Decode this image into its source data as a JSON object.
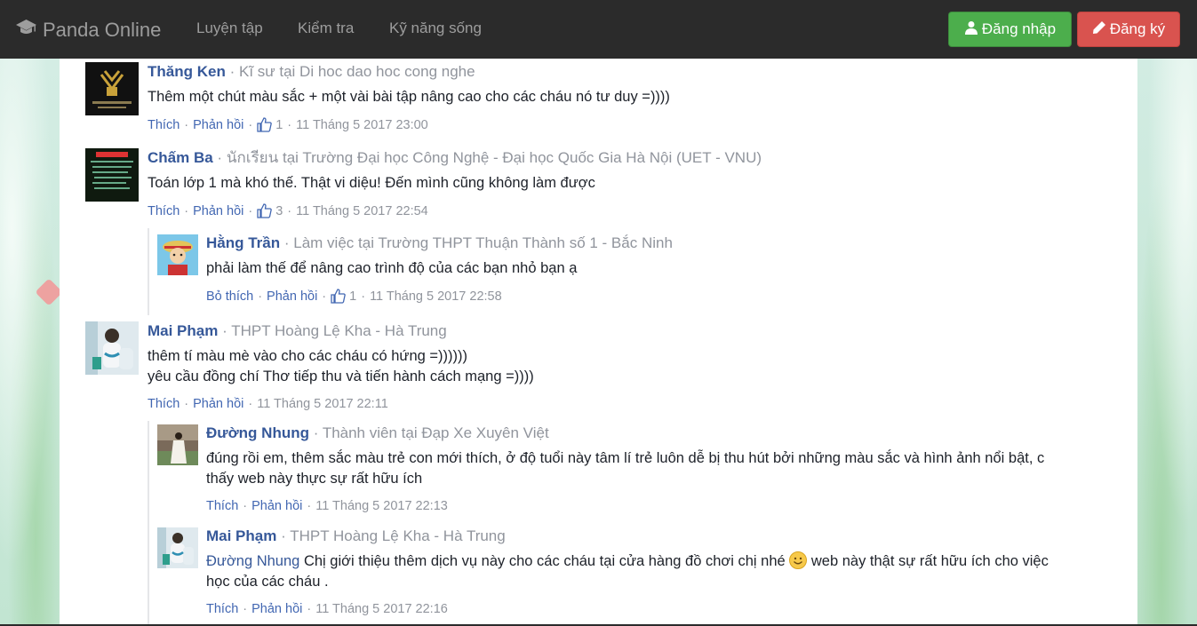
{
  "navbar": {
    "brand": "Panda Online",
    "brand_icon": "graduation-cap-icon",
    "links": [
      "Luyện tập",
      "Kiểm tra",
      "Kỹ năng sống"
    ],
    "login_label": "Đăng nhập",
    "signup_label": "Đăng ký",
    "login_color": "#4cae4c",
    "signup_color": "#d9534f"
  },
  "comments": [
    {
      "name": "Thăng Ken",
      "role": "Kĩ sư tại Di hoc dao hoc cong nghe",
      "text": [
        "Thêm một chút màu sắc + một vài bài tập nâng cao cho các cháu nó tư duy =))))"
      ],
      "like_label": "Thích",
      "reply_label": "Phản hồi",
      "likes": "1",
      "time": "11 Tháng 5 2017 23:00"
    },
    {
      "name": "Chấm Ba",
      "role": "นักเรียน tại Trường Đại học Công Nghệ - Đại học Quốc Gia Hà Nội (UET - VNU)",
      "text": [
        "Toán lớp 1 mà khó thế. Thật vi diệu! Đến mình cũng không làm được"
      ],
      "like_label": "Thích",
      "reply_label": "Phản hồi",
      "likes": "3",
      "time": "11 Tháng 5 2017 22:54",
      "replies": [
        {
          "name": "Hằng Trần",
          "role": "Làm việc tại Trường THPT Thuận Thành số 1 - Bắc Ninh",
          "text": [
            "phải làm thế để nâng cao trình độ của các bạn nhỏ bạn ạ"
          ],
          "like_label": "Bỏ thích",
          "reply_label": "Phản hồi",
          "likes": "1",
          "time": "11 Tháng 5 2017 22:58"
        }
      ]
    },
    {
      "name": "Mai Phạm",
      "role": "THPT Hoàng Lệ Kha - Hà Trung",
      "text": [
        "thêm tí màu mè vào cho các cháu có hứng =))))))",
        "yêu cầu đồng chí Thơ tiếp thu và tiến hành cách mạng =))))"
      ],
      "like_label": "Thích",
      "reply_label": "Phản hồi",
      "time": "11 Tháng 5 2017 22:11",
      "replies": [
        {
          "name": "Đường Nhung",
          "role": "Thành viên tại Đạp Xe Xuyên Việt",
          "text": [
            "đúng rồi em, thêm sắc màu trẻ con mới thích, ở độ tuổi này tâm lí trẻ luôn dễ bị thu hút bởi những màu sắc và hình ảnh nổi bật, c",
            "thấy web này thực sự rất hữu ích"
          ],
          "like_label": "Thích",
          "reply_label": "Phản hồi",
          "time": "11 Tháng 5 2017 22:13"
        },
        {
          "name": "Mai Phạm",
          "role": "THPT Hoàng Lệ Kha - Hà Trung",
          "mention": "Đường Nhung",
          "text_before_emoji": "Chị giới thiệu thêm dịch vụ này cho các cháu tại cửa hàng đồ chơi chị nhé",
          "text_after_emoji": "web này thật sự rất hữu ích cho việc",
          "text_line2": "học của các cháu .",
          "emoji": "smiley-icon",
          "like_label": "Thích",
          "reply_label": "Phản hồi",
          "time": "11 Tháng 5 2017 22:16"
        }
      ]
    }
  ],
  "separator": "·"
}
